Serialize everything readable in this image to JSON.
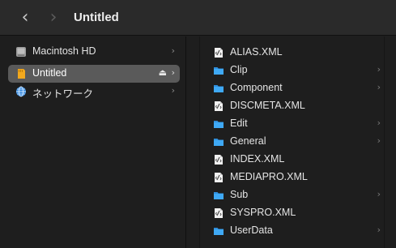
{
  "window": {
    "title": "Untitled"
  },
  "toolbar": {
    "back_glyph": "‹",
    "forward_glyph": "›"
  },
  "sidebar": {
    "items": [
      {
        "label": "Macintosh HD",
        "icon": "hard-drive-icon",
        "selected": false,
        "eject": false
      },
      {
        "label": "Untitled",
        "icon": "sd-card-icon",
        "selected": true,
        "eject": true
      },
      {
        "label": "ネットワーク",
        "icon": "network-globe-icon",
        "selected": false,
        "eject": false
      }
    ],
    "eject_glyph": "⏏",
    "chevron_glyph": "›"
  },
  "files": {
    "items": [
      {
        "label": "ALIAS.XML",
        "type": "xml"
      },
      {
        "label": "Clip",
        "type": "folder"
      },
      {
        "label": "Component",
        "type": "folder"
      },
      {
        "label": "DISCMETA.XML",
        "type": "xml"
      },
      {
        "label": "Edit",
        "type": "folder"
      },
      {
        "label": "General",
        "type": "folder"
      },
      {
        "label": "INDEX.XML",
        "type": "xml"
      },
      {
        "label": "MEDIAPRO.XML",
        "type": "xml"
      },
      {
        "label": "Sub",
        "type": "folder"
      },
      {
        "label": "SYSPRO.XML",
        "type": "xml"
      },
      {
        "label": "UserData",
        "type": "folder"
      }
    ],
    "chevron_glyph": "›"
  },
  "colors": {
    "folder": "#3fa9f5",
    "selected_row": "#5a5a5a",
    "sd_card": "#f2a81d"
  }
}
